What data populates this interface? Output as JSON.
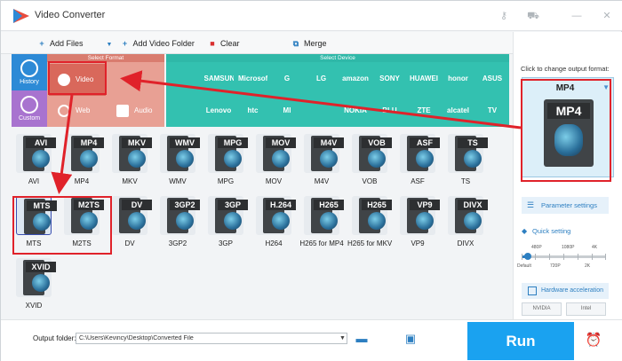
{
  "app": {
    "title": "Video Converter",
    "window_controls": {
      "key_icon": "key-icon",
      "cart_icon": "cart-icon",
      "minimize": "—",
      "close": "✕"
    }
  },
  "toolbar": {
    "add_files": "Add Files",
    "add_video_folder": "Add Video Folder",
    "clear": "Clear",
    "merge": "Merge"
  },
  "left_tabs": [
    {
      "label": "History",
      "icon": "clock-icon"
    },
    {
      "label": "Custom",
      "icon": "person-icon"
    }
  ],
  "sections": {
    "select_format": "Select Format",
    "select_device": "Select Device"
  },
  "format_categories": [
    {
      "label": "Video",
      "icon": "play-icon"
    },
    {
      "label": "Web",
      "icon": "globe-icon"
    },
    {
      "label": "Audio",
      "icon": "speaker-icon"
    }
  ],
  "devices_row1": [
    "",
    "SAMSUNG",
    "Microsoft",
    "G",
    "LG",
    "amazon",
    "SONY",
    "HUAWEI",
    "honor",
    "ASUS"
  ],
  "devices_row2": [
    "",
    "Lenovo",
    "htc",
    "MI",
    "",
    "NOKIA",
    "BLU",
    "ZTE",
    "alcatel",
    "TV"
  ],
  "formats_row1": [
    {
      "badge": "AVI",
      "caption": "AVI"
    },
    {
      "badge": "MP4",
      "caption": "MP4"
    },
    {
      "badge": "MKV",
      "caption": "MKV"
    },
    {
      "badge": "WMV",
      "caption": "WMV"
    },
    {
      "badge": "MPG",
      "caption": "MPG"
    },
    {
      "badge": "MOV",
      "caption": "MOV"
    },
    {
      "badge": "M4V",
      "caption": "M4V"
    },
    {
      "badge": "VOB",
      "caption": "VOB"
    },
    {
      "badge": "ASF",
      "caption": "ASF"
    },
    {
      "badge": "TS",
      "caption": "TS"
    }
  ],
  "formats_row2": [
    {
      "badge": "MTS",
      "caption": "MTS"
    },
    {
      "badge": "M2TS",
      "caption": "M2TS"
    },
    {
      "badge": "DV",
      "caption": "DV"
    },
    {
      "badge": "3GP2",
      "caption": "3GP2"
    },
    {
      "badge": "3GP",
      "caption": "3GP"
    },
    {
      "badge": "H.264",
      "caption": "H264"
    },
    {
      "badge": "H265",
      "caption": "H265 for MP4"
    },
    {
      "badge": "H265",
      "caption": "H265 for MKV"
    },
    {
      "badge": "VP9",
      "caption": "VP9"
    },
    {
      "badge": "DIVX",
      "caption": "DIVX"
    }
  ],
  "formats_row3": [
    {
      "badge": "XVID",
      "caption": "XVID"
    }
  ],
  "right_panel": {
    "hint": "Click to change output format:",
    "selected_format": "MP4",
    "parameter_settings": "Parameter settings",
    "quick_setting": "Quick setting",
    "quality_labels_top": [
      "480P",
      "1080P",
      "4K"
    ],
    "quality_labels_bottom": [
      "Default",
      "720P",
      "2K"
    ],
    "hardware_acceleration": "Hardware acceleration",
    "chips": [
      "NVIDIA",
      "Intel"
    ]
  },
  "bottom": {
    "output_folder_label": "Output folder:",
    "output_path": "C:\\Users\\Kevincy\\Desktop\\Converted File",
    "run": "Run"
  },
  "colors": {
    "accent_blue": "#1aa2f0",
    "format_red": "#d97c6f",
    "device_teal": "#2fb8a8",
    "highlight_red": "#e0222a",
    "history_blue": "#2d8ad6",
    "custom_purple": "#a873cf"
  }
}
